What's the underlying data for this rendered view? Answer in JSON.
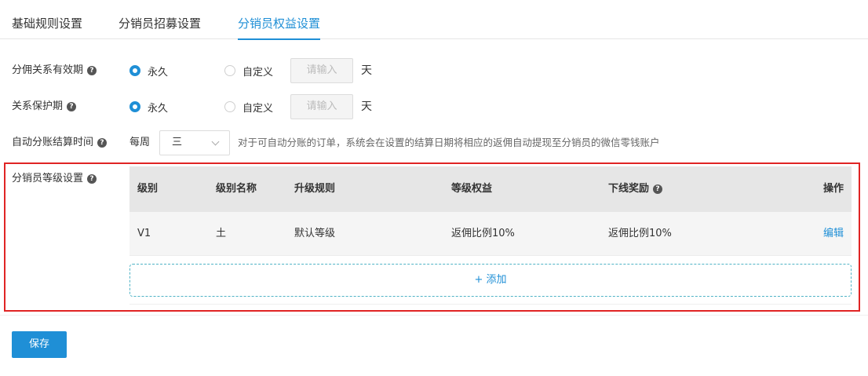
{
  "tabs": [
    {
      "label": "基础规则设置",
      "active": false
    },
    {
      "label": "分销员招募设置",
      "active": false
    },
    {
      "label": "分销员权益设置",
      "active": true
    }
  ],
  "commission_validity": {
    "label": "分佣关系有效期",
    "options": [
      "永久",
      "自定义"
    ],
    "selected": "永久",
    "input_placeholder": "请输入",
    "unit": "天"
  },
  "protection_period": {
    "label": "关系保护期",
    "options": [
      "永久",
      "自定义"
    ],
    "selected": "永久",
    "input_placeholder": "请输入",
    "unit": "天"
  },
  "auto_settlement": {
    "label": "自动分账结算时间",
    "prefix": "每周",
    "weekday": "三",
    "hint": "对于可自动分账的订单，系统会在设置的结算日期将相应的返佣自动提现至分销员的微信零钱账户"
  },
  "level_settings": {
    "label": "分销员等级设置",
    "columns": [
      "级别",
      "级别名称",
      "升级规则",
      "等级权益",
      "下线奖励",
      "操作"
    ],
    "rows": [
      {
        "level": "V1",
        "name": "土",
        "rule": "默认等级",
        "benefit": "返佣比例10%",
        "downline_reward": "返佣比例10%",
        "action": "编辑"
      }
    ],
    "add_label": "+ 添加"
  },
  "save_label": "保存",
  "colors": {
    "accent": "#1f8fd6",
    "highlight_border": "#e02424"
  },
  "icons": {
    "help": "question-circle-icon",
    "dropdown": "chevron-down-icon"
  }
}
